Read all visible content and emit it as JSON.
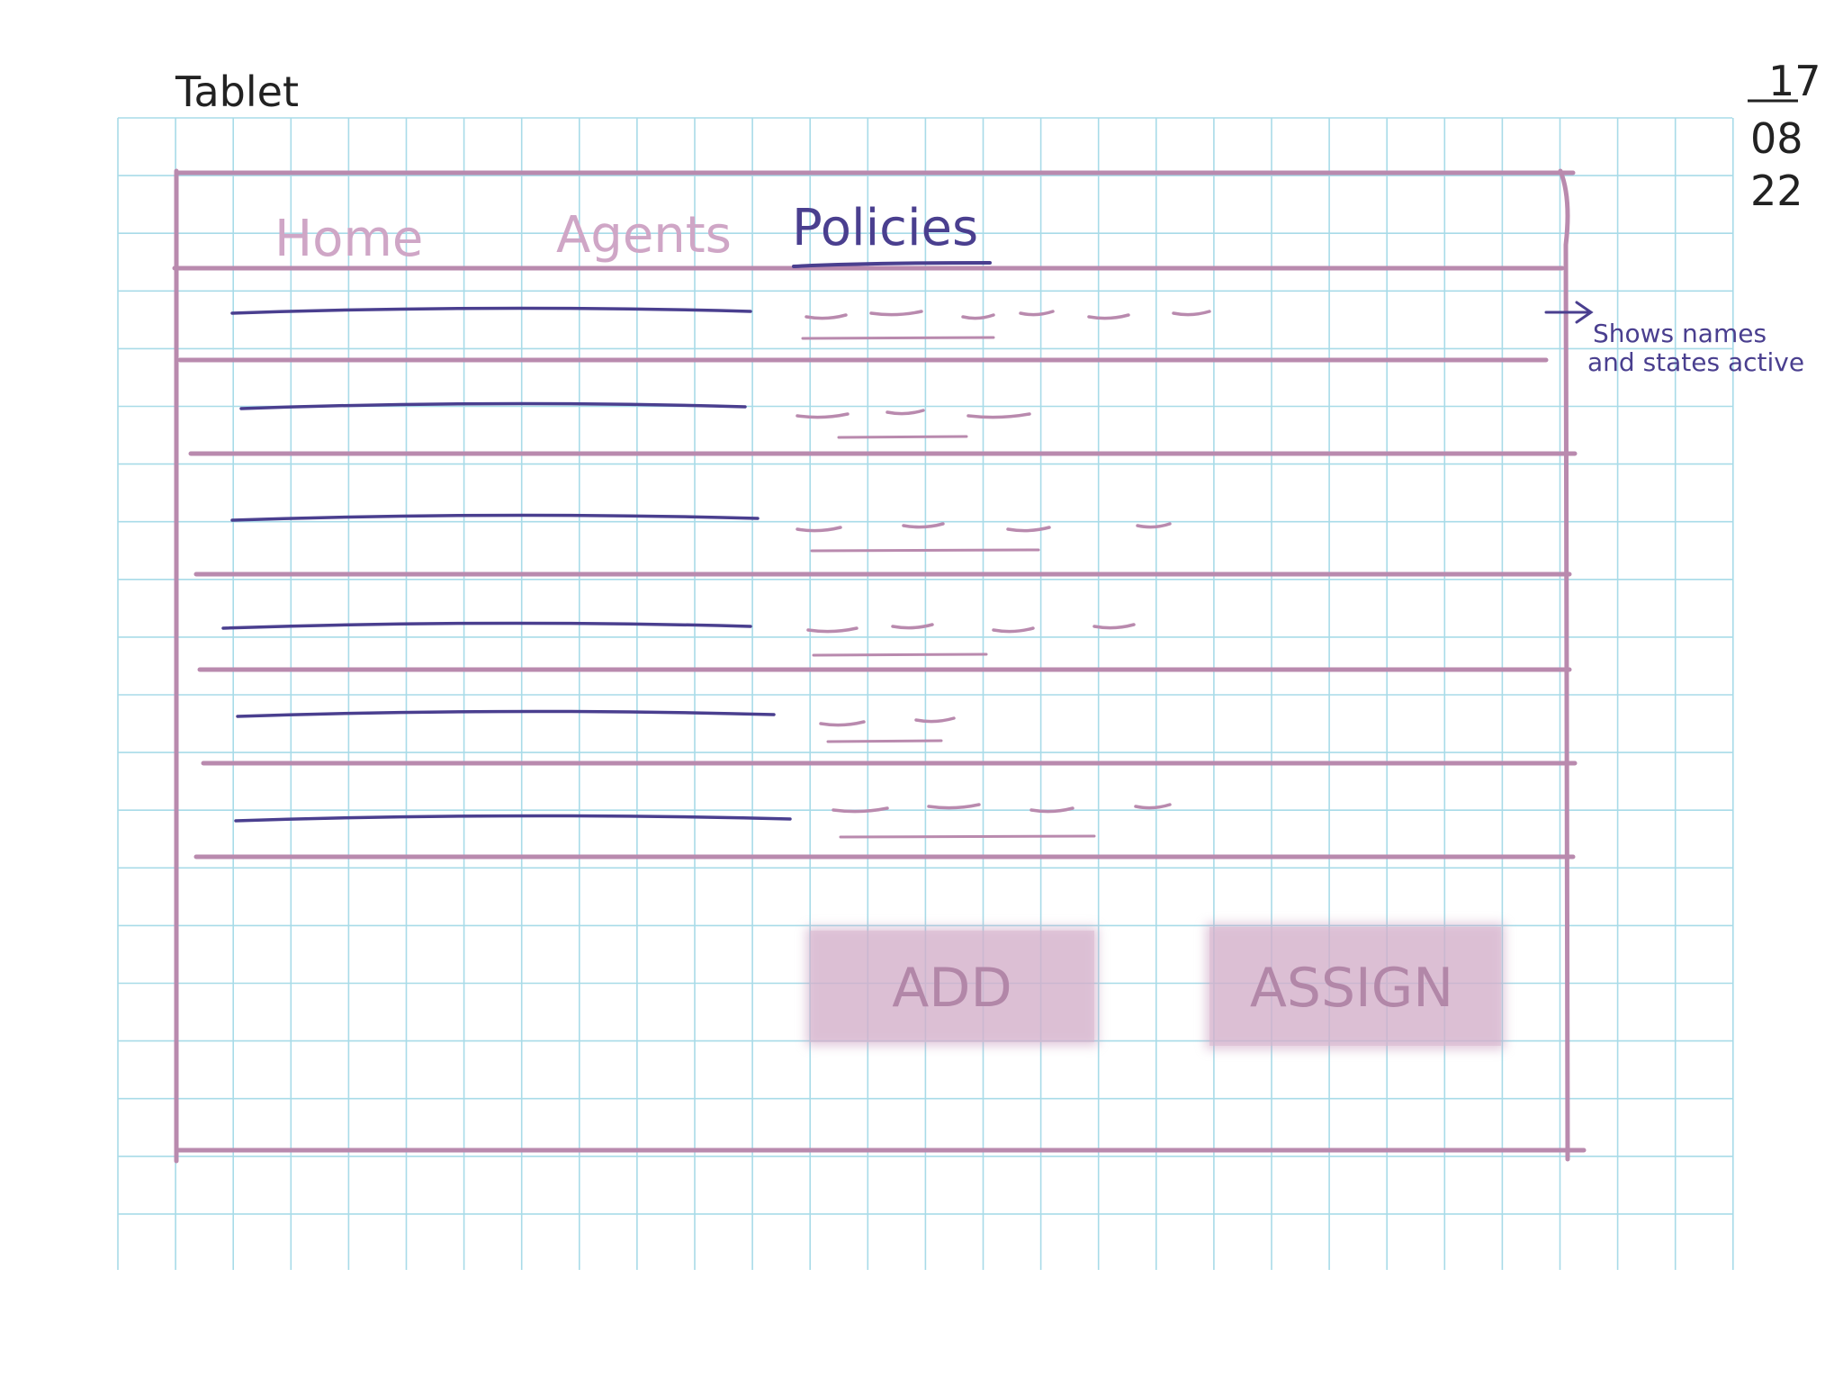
{
  "page": {
    "device_label": "Tablet",
    "date": {
      "day": "17",
      "month": "08",
      "year": "22"
    }
  },
  "nav": {
    "tabs": [
      {
        "label": "Home",
        "active": false
      },
      {
        "label": "Agents",
        "active": false
      },
      {
        "label": "Policies",
        "active": true
      }
    ]
  },
  "list": {
    "row_count": 6
  },
  "annotation": {
    "line1": "Shows names",
    "line2": "and states active"
  },
  "actions": {
    "add_label": "ADD",
    "assign_label": "ASSIGN"
  },
  "colors": {
    "grid": "#a8dbe8",
    "frame": "#b98aae",
    "ink_dark": "#4a3f8f",
    "ink_light": "#c79bbd",
    "button_fill": "#c89bbd",
    "text_black": "#222222"
  }
}
